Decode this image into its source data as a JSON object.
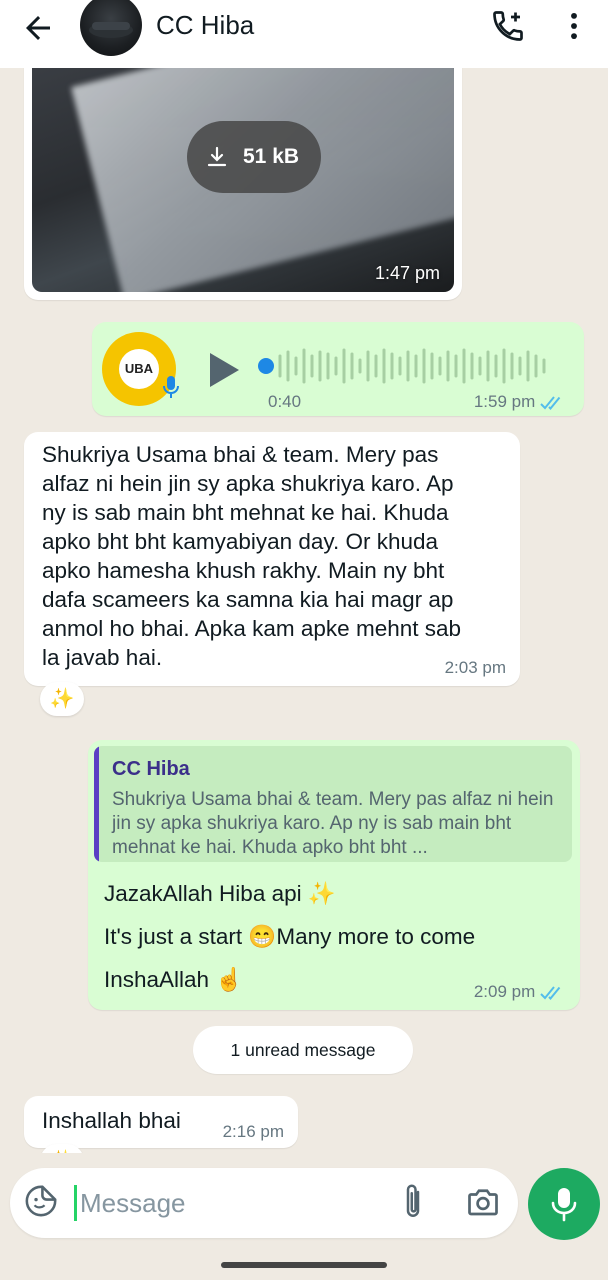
{
  "header": {
    "contact_name": "CC Hiba",
    "icons": [
      "back-arrow-icon",
      "call-add-icon",
      "more-vert-icon"
    ]
  },
  "media_message": {
    "download_size": "51 kB",
    "time": "1:47 pm"
  },
  "voice_message": {
    "duration": "0:40",
    "time": "1:59 pm",
    "logo_text": "UBA",
    "status": "read"
  },
  "incoming_message_1": {
    "lines": [
      "Shukriya Usama bhai & team. Mery pas",
      "alfaz ni hein jin sy apka shukriya karo. Ap",
      "ny is sab main bht mehnat ke hai. Khuda",
      "apko bht bht kamyabiyan day. Or khuda",
      "apko hamesha khush rakhy. Main ny bht",
      "dafa scameers ka samna kia hai magr ap",
      "anmol ho bhai. Apka kam apke mehnt sab",
      "la javab hai."
    ],
    "time": "2:03 pm",
    "reaction": "✨"
  },
  "reply_message": {
    "quoted_name": "CC Hiba",
    "quoted_text": "Shukriya Usama bhai & team. Mery pas alfaz ni hein jin sy apka shukriya karo. Ap ny is sab main bht mehnat ke hai. Khuda apko bht bht ...",
    "line_1": "JazakAllah Hiba api ✨",
    "line_2": "It's just a start 😁Many more to come",
    "line_3": "InshaAllah ☝️",
    "time": "2:09 pm"
  },
  "unread_divider": "1 unread message",
  "incoming_message_2": {
    "text": "Inshallah bhai",
    "time": "2:16 pm",
    "reaction": "✨"
  },
  "composer": {
    "placeholder": "Message"
  },
  "colors": {
    "incoming_bg": "#ffffff",
    "outgoing_bg": "#d9fdd3",
    "accent_green": "#1daa61",
    "read_tick": "#53bdeb",
    "wallpaper": "#efeae2"
  }
}
